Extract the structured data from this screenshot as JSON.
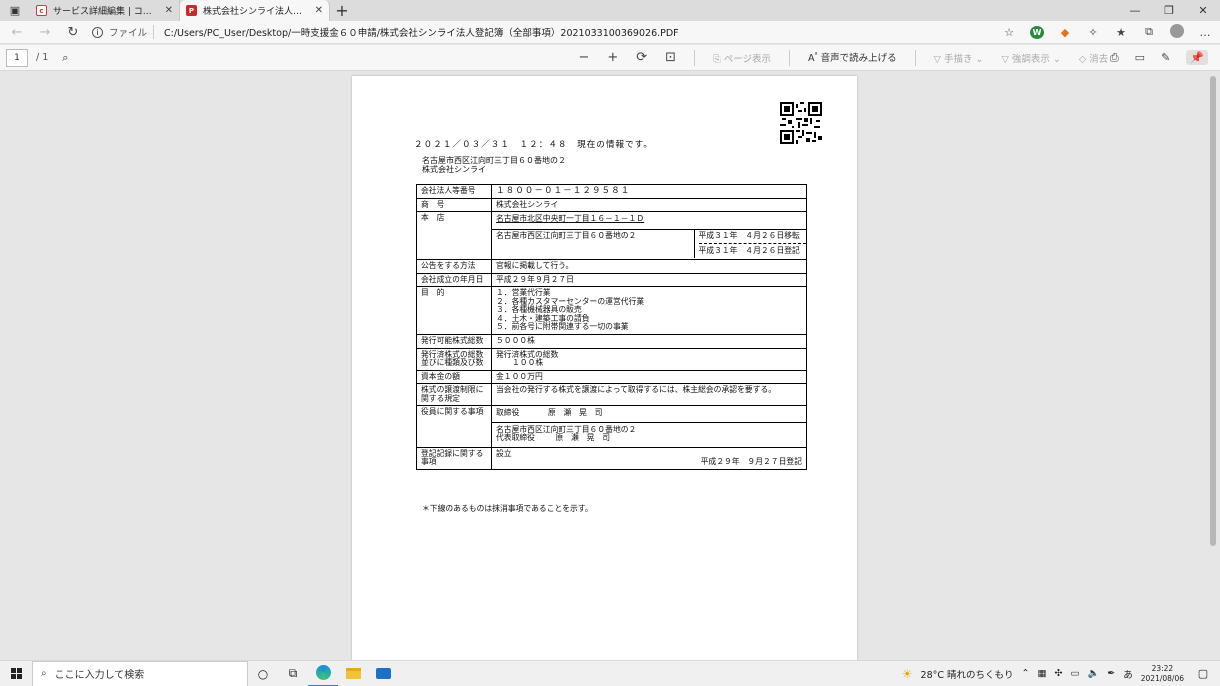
{
  "browser": {
    "tabs": [
      {
        "title": "サービス詳細編集 | ココナラ",
        "icon": "coconala-icon",
        "active": false
      },
      {
        "title": "株式会社シンライ法人登記簿（全部",
        "icon": "pdf-icon",
        "active": true
      }
    ],
    "address": {
      "scheme_label": "ファイル",
      "path": "C:/Users/PC_User/Desktop/一時支援金６０申請/株式会社シンライ法人登記簿（全部事項）2021033100369026.PDF"
    }
  },
  "pdf_toolbar": {
    "page_current": "1",
    "page_total": "/ 1",
    "page_view_label": "ページ表示",
    "read_aloud_label": "音声で読み上げる",
    "draw_label": "手描き",
    "highlight_label": "強調表示",
    "erase_label": "消去"
  },
  "document": {
    "timestamp_line": "２０２１／０３／３１　１２：４８　現在の情報です。",
    "header_address": "名古屋市西区江向町三丁目６０番地の２",
    "header_company": "株式会社シンライ",
    "rows": {
      "corp_number": {
        "label": "会社法人等番号",
        "value": "１８００－０１－１２９５８１"
      },
      "trade_name": {
        "label": "商　号",
        "value": "株式会社シンライ"
      },
      "head_office": {
        "label": "本　店",
        "old": "名古屋市北区中央町一丁目１６－１－１Ｄ",
        "new": "名古屋市西区江向町三丁目６０番地の２",
        "date_moved": "平成３１年　４月２６日移転",
        "date_registered": "平成３１年　４月２６日登記"
      },
      "public_notice": {
        "label": "公告をする方法",
        "value": "官報に掲載して行う。"
      },
      "established": {
        "label": "会社成立の年月日",
        "value": "平成２９年９月２７日"
      },
      "purpose": {
        "label": "目　的",
        "items": [
          "１．営業代行業",
          "２．各種カスタマーセンターの運営代行業",
          "３．各種機械器具の販売",
          "４．土木・建築工事の請負",
          "５．前各号に附帯関連する一切の事業"
        ]
      },
      "authorized_shares": {
        "label": "発行可能株式総数",
        "value": "５０００株"
      },
      "issued_shares": {
        "label_line1": "発行済株式の総数",
        "label_line2": "並びに種類及び数",
        "value_line1": "発行済株式の総数",
        "value_line2": "１００株"
      },
      "capital": {
        "label": "資本金の額",
        "value": "金１００万円"
      },
      "transfer_restriction": {
        "label_line1": "株式の譲渡制限に",
        "label_line2": "関する規定",
        "value": "当会社の発行する株式を譲渡によって取得するには、株主総会の承認を要する。"
      },
      "officers": {
        "label": "役員に関する事項",
        "director_title": "取締役",
        "director_name": "原　瀬　晃　司",
        "rep_address": "名古屋市西区江向町三丁目６０番地の２",
        "rep_title": "代表取締役",
        "rep_name": "原　瀬　晃　司"
      },
      "registry_record": {
        "label_line1": "登記記録に関する",
        "label_line2": "事項",
        "value": "設立",
        "date": "平成２９年　９月２７日登記"
      }
    },
    "footnote": "＊下線のあるものは抹消事項であることを示す。"
  },
  "taskbar": {
    "search_placeholder": "ここに入力して検索",
    "weather": "28°C  晴れのちくもり",
    "time": "23:22",
    "date": "2021/08/06"
  }
}
